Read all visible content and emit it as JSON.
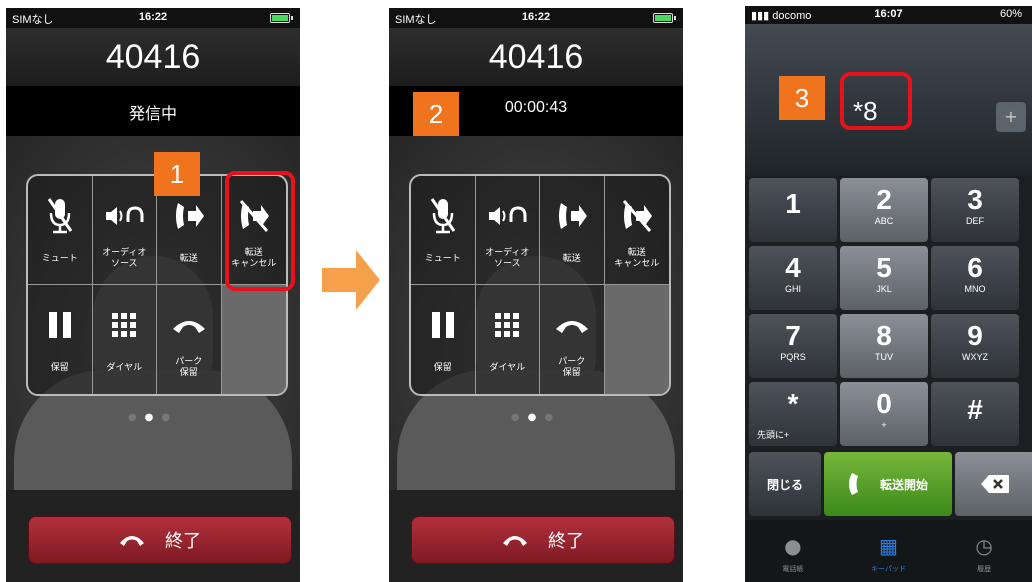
{
  "phone1": {
    "status": {
      "carrier": "SIMなし",
      "time": "16:22"
    },
    "number": "40416",
    "call_status": "発信中",
    "buttons": [
      {
        "label": "ミュート",
        "icon": "mic-off-icon"
      },
      {
        "label": "オーディオ\nソース",
        "icon": "audio-source-icon"
      },
      {
        "label": "転送",
        "icon": "transfer-icon"
      },
      {
        "label": "転送\nキャンセル",
        "icon": "transfer-cancel-icon"
      },
      {
        "label": "保留",
        "icon": "pause-icon"
      },
      {
        "label": "ダイヤル",
        "icon": "dialpad-icon"
      },
      {
        "label": "パーク\n保留",
        "icon": "park-hold-icon"
      }
    ],
    "end_label": "終了",
    "badge": "1"
  },
  "phone2": {
    "status": {
      "carrier": "SIMなし",
      "time": "16:22"
    },
    "number": "40416",
    "call_timer": "00:00:43",
    "buttons": [
      {
        "label": "ミュート",
        "icon": "mic-off-icon"
      },
      {
        "label": "オーディオ\nソース",
        "icon": "audio-source-icon"
      },
      {
        "label": "転送",
        "icon": "transfer-icon"
      },
      {
        "label": "転送\nキャンセル",
        "icon": "transfer-cancel-icon"
      },
      {
        "label": "保留",
        "icon": "pause-icon"
      },
      {
        "label": "ダイヤル",
        "icon": "dialpad-icon"
      },
      {
        "label": "パーク\n保留",
        "icon": "park-hold-icon"
      }
    ],
    "end_label": "終了",
    "badge": "2"
  },
  "phone3": {
    "status": {
      "carrier": "docomo",
      "time": "16:07",
      "battery": "60%"
    },
    "display_value": "*8",
    "badge": "3",
    "keys": [
      {
        "digit": "1",
        "letters": ""
      },
      {
        "digit": "2",
        "letters": "ABC"
      },
      {
        "digit": "3",
        "letters": "DEF"
      },
      {
        "digit": "4",
        "letters": "GHI"
      },
      {
        "digit": "5",
        "letters": "JKL"
      },
      {
        "digit": "6",
        "letters": "MNO"
      },
      {
        "digit": "7",
        "letters": "PQRS"
      },
      {
        "digit": "8",
        "letters": "TUV"
      },
      {
        "digit": "9",
        "letters": "WXYZ"
      },
      {
        "digit": "*",
        "letters": "先頭に+"
      },
      {
        "digit": "0",
        "letters": "+"
      },
      {
        "digit": "#",
        "letters": ""
      }
    ],
    "close_label": "閉じる",
    "start_transfer_label": "転送開始",
    "tabs": [
      {
        "label": "電話帳",
        "icon": "contacts-icon"
      },
      {
        "label": "キーパッド",
        "icon": "keypad-icon"
      },
      {
        "label": "履歴",
        "icon": "history-icon"
      }
    ]
  },
  "colors": {
    "badge": "#f0741e",
    "highlight": "#e8121e",
    "end_button": "#a52835",
    "transfer_button": "#5aa02c",
    "tab_active": "#2a7de1"
  }
}
